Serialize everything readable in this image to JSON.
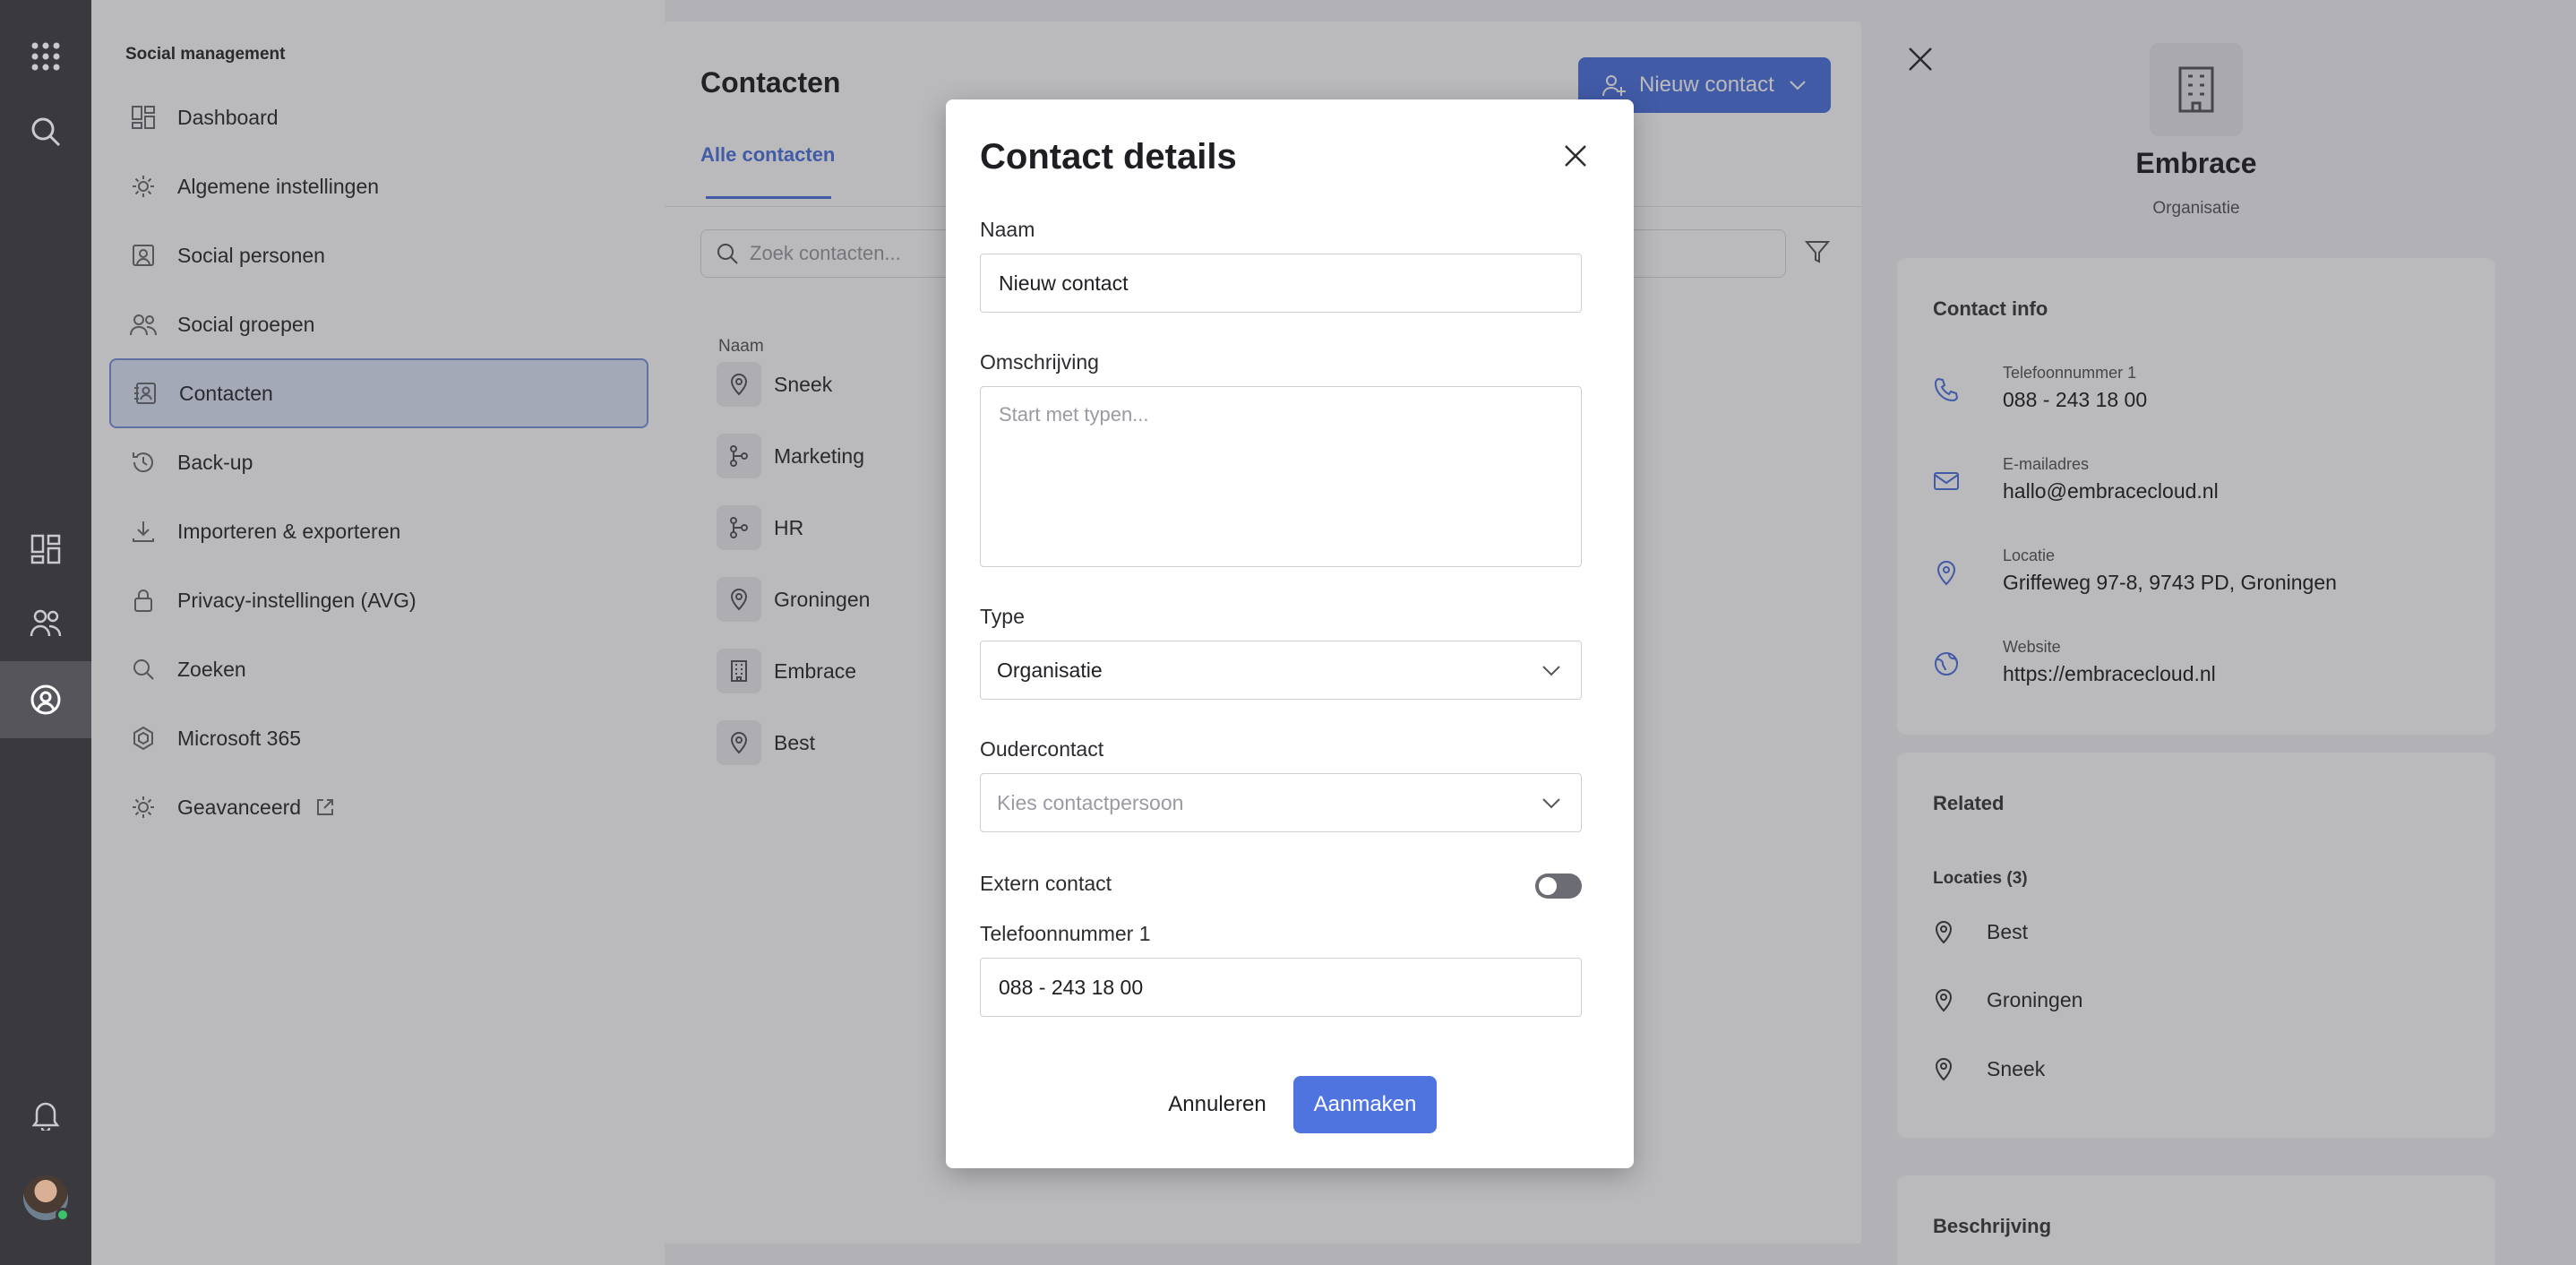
{
  "rail": {
    "icons": [
      "apps-grid-icon",
      "search-icon",
      "dashboard-icon",
      "people-icon",
      "contacts-app-icon",
      "bell-icon"
    ],
    "active": "contacts-app-icon"
  },
  "sidebar": {
    "title": "Social management",
    "items": [
      {
        "label": "Dashboard",
        "icon": "dashboard-icon"
      },
      {
        "label": "Algemene instellingen",
        "icon": "gear-icon"
      },
      {
        "label": "Social personen",
        "icon": "person-card-icon"
      },
      {
        "label": "Social groepen",
        "icon": "people-icon"
      },
      {
        "label": "Contacten",
        "icon": "contact-book-icon",
        "active": true
      },
      {
        "label": "Back-up",
        "icon": "history-icon"
      },
      {
        "label": "Importeren & exporteren",
        "icon": "download-icon"
      },
      {
        "label": "Privacy-instellingen (AVG)",
        "icon": "lock-icon"
      },
      {
        "label": "Zoeken",
        "icon": "search-icon"
      },
      {
        "label": "Microsoft 365",
        "icon": "m365-icon"
      },
      {
        "label": "Geavanceerd",
        "icon": "gear-icon",
        "external": true
      }
    ]
  },
  "contacts": {
    "title": "Contacten",
    "new_button": "Nieuw contact",
    "tab_all": "Alle contacten",
    "search_placeholder": "Zoek contacten...",
    "column_name": "Naam",
    "rows": [
      {
        "name": "Sneek",
        "icon": "location-pin-icon"
      },
      {
        "name": "Marketing",
        "icon": "branch-icon"
      },
      {
        "name": "HR",
        "icon": "branch-icon"
      },
      {
        "name": "Groningen",
        "icon": "location-pin-icon"
      },
      {
        "name": "Embrace",
        "icon": "building-icon"
      },
      {
        "name": "Best",
        "icon": "location-pin-icon"
      }
    ]
  },
  "detail": {
    "name": "Embrace",
    "type": "Organisatie",
    "contact_info_title": "Contact info",
    "info": [
      {
        "key": "Telefoonnummer 1",
        "value": "088 - 243 18 00",
        "icon": "phone-icon"
      },
      {
        "key": "E-mailadres",
        "value": "hallo@embracecloud.nl",
        "icon": "mail-icon"
      },
      {
        "key": "Locatie",
        "value": "Griffeweg 97-8, 9743 PD, Groningen",
        "icon": "location-pin-icon"
      },
      {
        "key": "Website",
        "value": "https://embracecloud.nl",
        "icon": "globe-icon"
      }
    ],
    "related_title": "Related",
    "locations_title": "Locaties (3)",
    "locations": [
      "Best",
      "Groningen",
      "Sneek"
    ],
    "description_title": "Beschrijving"
  },
  "modal": {
    "title": "Contact details",
    "name_label": "Naam",
    "name_value": "Nieuw contact",
    "description_label": "Omschrijving",
    "description_placeholder": "Start met typen...",
    "type_label": "Type",
    "type_value": "Organisatie",
    "parent_label": "Oudercontact",
    "parent_placeholder": "Kies contactpersoon",
    "external_label": "Extern contact",
    "external_on": false,
    "phone_label": "Telefoonnummer 1",
    "phone_value": "088 - 243 18 00",
    "cancel_label": "Annuleren",
    "create_label": "Aanmaken"
  },
  "colors": {
    "accent": "#4f74e0",
    "rail": "#3a3a3e",
    "active_item_bg": "#dfe6fa",
    "overlay": "rgba(40,40,46,0.32)"
  }
}
